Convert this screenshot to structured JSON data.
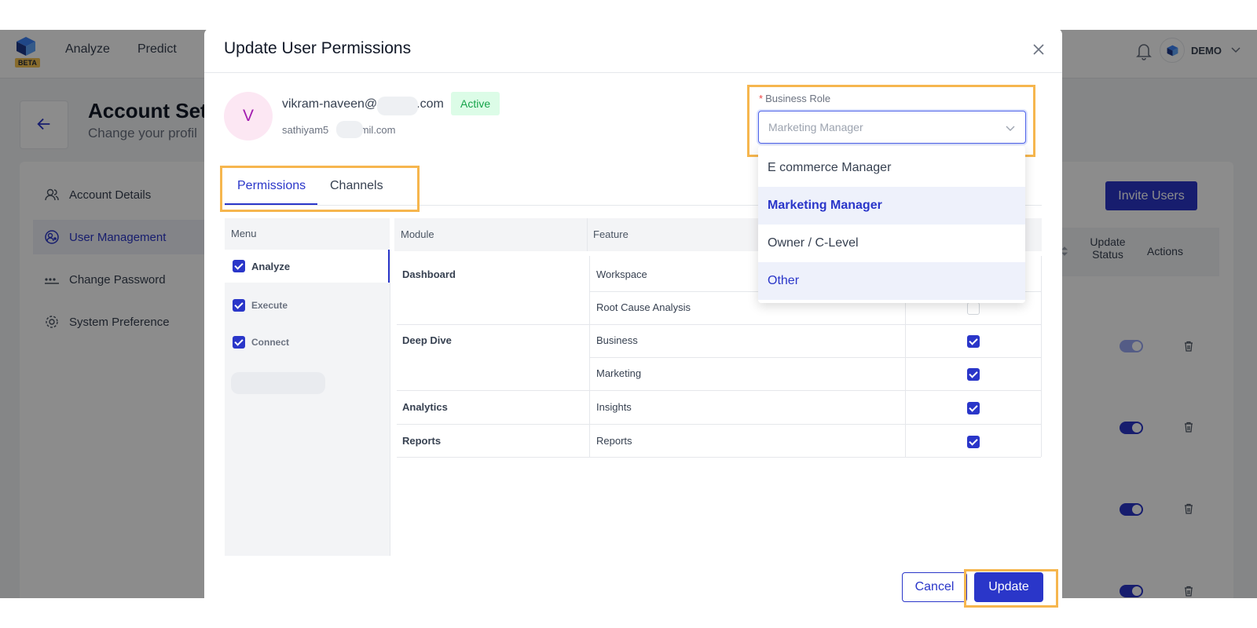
{
  "app": {
    "badge": "BETA",
    "nav": [
      "Analyze",
      "Predict"
    ],
    "account_name": "DEMO"
  },
  "page": {
    "title": "Account Set",
    "subtitle": "Change your profil"
  },
  "sidebar": {
    "items": [
      {
        "label": "Account Details",
        "icon": "users-icon",
        "active": false
      },
      {
        "label": "User Management",
        "icon": "user-settings-icon",
        "active": true
      },
      {
        "label": "Change Password",
        "icon": "password-dots-icon",
        "active": false
      },
      {
        "label": "System Preference",
        "icon": "gear-icon",
        "active": false
      }
    ]
  },
  "background_table": {
    "invite_label": "Invite Users",
    "columns": [
      "Update Status",
      "Actions"
    ],
    "rows": [
      {
        "status_on": true
      },
      {
        "status_on": true
      },
      {
        "status_on": true
      },
      {
        "status_on": true
      }
    ]
  },
  "modal": {
    "title": "Update User Permissions",
    "user": {
      "initial": "V",
      "email_start": "vikram-naveen@s",
      "email_end": ".com",
      "status": "Active",
      "secondary_start": "sathiyam5",
      "secondary_end": "gamil.com"
    },
    "tabs": [
      {
        "label": "Permissions",
        "active": true
      },
      {
        "label": "Channels",
        "active": false
      }
    ],
    "menu": {
      "header": "Menu",
      "items": [
        {
          "label": "Analyze",
          "checked": true,
          "selected": true
        },
        {
          "label": "Execute",
          "checked": true,
          "selected": false
        },
        {
          "label": "Connect",
          "checked": true,
          "selected": false
        }
      ]
    },
    "table": {
      "columns": [
        "Module",
        "Feature"
      ],
      "rows": [
        {
          "module": "Dashboard",
          "feature": "Workspace",
          "checked": true
        },
        {
          "module": "",
          "feature": "Root Cause Analysis",
          "checked": false
        },
        {
          "module": "Deep Dive",
          "feature": "Business",
          "checked": true
        },
        {
          "module": "",
          "feature": "Marketing",
          "checked": true
        },
        {
          "module": "Analytics",
          "feature": "Insights",
          "checked": true
        },
        {
          "module": "Reports",
          "feature": "Reports",
          "checked": true
        }
      ]
    },
    "business_role": {
      "label": "Business Role",
      "required_mark": "*",
      "value": "Marketing Manager",
      "options": [
        "E commerce Manager",
        "Marketing Manager",
        "Owner / C-Level",
        "Other"
      ],
      "selected_index": 1,
      "hover_index": 3
    },
    "buttons": {
      "cancel": "Cancel",
      "update": "Update"
    }
  },
  "colors": {
    "primary": "#2a36c9",
    "highlight": "#f6b64e",
    "success": "#16a34a"
  }
}
